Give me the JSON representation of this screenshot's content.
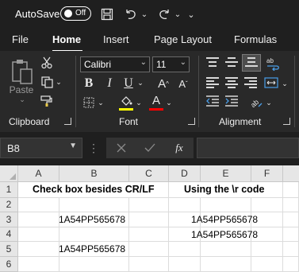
{
  "titlebar": {
    "autosave_label": "AutoSave",
    "autosave_state": "Off",
    "icons": [
      "save-icon",
      "undo-icon",
      "redo-icon",
      "customize-qat-icon"
    ]
  },
  "tabs": [
    {
      "label": "File",
      "active": false
    },
    {
      "label": "Home",
      "active": true
    },
    {
      "label": "Insert",
      "active": false
    },
    {
      "label": "Page Layout",
      "active": false
    },
    {
      "label": "Formulas",
      "active": false
    }
  ],
  "ribbon": {
    "clipboard": {
      "label": "Clipboard",
      "paste_label": "Paste"
    },
    "font": {
      "label": "Font",
      "font_name": "Calibri",
      "font_size": "11",
      "fill_color": "#ffff00",
      "font_color": "#ff0000"
    },
    "alignment": {
      "label": "Alignment"
    }
  },
  "formula_bar": {
    "name_box": "B8",
    "fx_label": "fx",
    "value": ""
  },
  "sheet": {
    "columns": [
      "A",
      "B",
      "C",
      "D",
      "E",
      "F"
    ],
    "rows": [
      "1",
      "2",
      "3",
      "4",
      "5",
      "6"
    ],
    "cells": {
      "B1": "Check box besides CR/LF",
      "D1": "Using the \\r code",
      "B3": "1A54PP565678",
      "D3": "1A54PP565678",
      "D4": "1A54PP565678",
      "B5": "1A54PP565678"
    }
  },
  "colors": {
    "accent_green": "#107c41",
    "ribbon_bg": "#292929",
    "window_bg": "#1f1f1f"
  }
}
